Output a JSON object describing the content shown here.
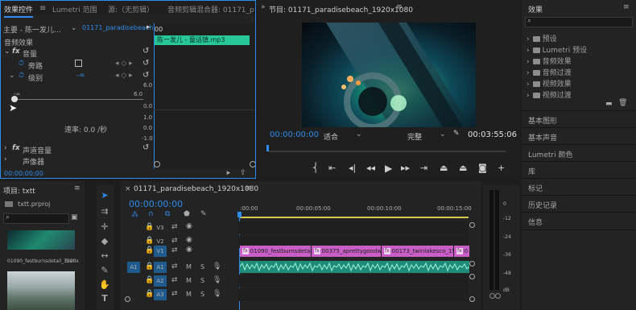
{
  "effect_controls": {
    "tabs": [
      "效果控件",
      "Lumetri 范围",
      "源:（无剪辑）",
      "音频剪辑混合器: 01171_p"
    ],
    "master_label": "主要 - 陈一发儿...",
    "sequence_label": "01171_paradisebeach...",
    "section_audio": "音频效果",
    "fx_volume": "音量",
    "bypass_label": "旁路",
    "level_label": "级别",
    "level_value": "-∞",
    "slider_min": "-∞",
    "slider_max": "6.0",
    "speed_label": "速率: 0.0 /秒",
    "fx_channel_volume": "声道音量",
    "fx_panner": "声像器",
    "timecode": "00:00:00:00",
    "mini_timeline_start": "00",
    "mini_clip_name": "陈一发儿 - 童话镇.mp3",
    "scale": [
      "6.0",
      "0.0",
      "1.0",
      "0.0",
      "-1.0"
    ]
  },
  "program_monitor": {
    "title": "节目: 01171_paradisebeach_1920x1080",
    "timecode": "00:00:00:00",
    "fit_label": "适合",
    "quality_label": "完整",
    "duration": "00:03:55:06"
  },
  "effects_panel": {
    "title": "效果",
    "search_placeholder": "",
    "tree": [
      "预设",
      "Lumetri 预设",
      "音频效果",
      "音频过渡",
      "视频效果",
      "视频过渡"
    ],
    "sections": [
      "基本图形",
      "基本声音",
      "Lumetri 颜色",
      "库",
      "标记",
      "历史记录",
      "信息"
    ]
  },
  "project_panel": {
    "title": "项目: txtt",
    "filename": "txtt.prproj",
    "thumb1_name": "01090_festburnsdetail_1920x",
    "thumb1_duration": "5:00"
  },
  "timeline": {
    "sequence_tab": "01171_paradisebeach_1920x1080",
    "timecode": "00:00:00:00",
    "ruler": [
      ":00:00",
      "00:00:05:00",
      "00:00:10:00",
      "00:00:15:00"
    ],
    "video_tracks": [
      "V3",
      "V2",
      "V1"
    ],
    "audio_tracks": [
      "A1",
      "A2",
      "A3"
    ],
    "source_patch": "A1",
    "clips": [
      "01090_festburnsdetail_1920x",
      "00375_aprettygoodwell_1920",
      "00173_twinlakesco_1920x10",
      "0"
    ],
    "mute_label": "M",
    "solo_label": "S"
  },
  "meter": {
    "scale": [
      "0",
      "-12",
      "-24",
      "-36",
      "-48",
      "dB"
    ]
  },
  "colors": {
    "accent": "#2d8ceb",
    "video_clip": "#c95fc6",
    "audio_clip": "#1f8c7a",
    "audio_clip_mini": "#27c79a",
    "playhead": "#2d8ceb"
  }
}
